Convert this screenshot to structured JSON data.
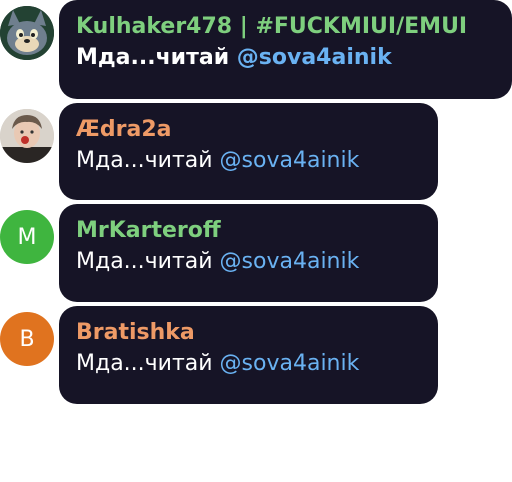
{
  "messages": [
    {
      "author": "Kulhaker478 | #FUCKMIUI/EMUI",
      "author_color": "#7ecf7e",
      "text": "Мда...читай",
      "mention": "@sova4ainik",
      "avatar": "tom-cat-avatar-icon"
    },
    {
      "author": "Ædra2a",
      "author_color": "#ee9a66",
      "text": "Мда...читай",
      "mention": "@sova4ainik",
      "avatar": "person-photo-avatar"
    },
    {
      "author": "MrKarteroff",
      "author_color": "#7ecf7e",
      "text": "Мда...читай",
      "mention": "@sova4ainik",
      "avatar_letter": "M",
      "avatar_color": "#3fb53f"
    },
    {
      "author": "Bratishka",
      "author_color": "#ee9a66",
      "text": "Мда...читай",
      "mention": "@sova4ainik",
      "avatar_letter": "B",
      "avatar_color": "#e0731f"
    }
  ],
  "colors": {
    "bubble": "#161426",
    "mention": "#6ab2f2"
  }
}
